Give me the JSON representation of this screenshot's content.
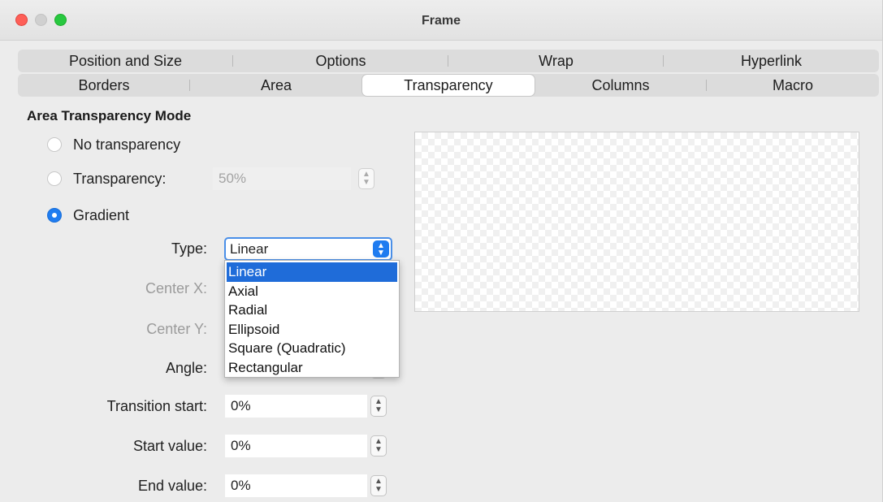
{
  "window": {
    "title": "Frame"
  },
  "tabs": {
    "row1": [
      "Position and Size",
      "Options",
      "Wrap",
      "Hyperlink"
    ],
    "row2": [
      "Borders",
      "Area",
      "Transparency",
      "Columns",
      "Macro"
    ],
    "active": "Transparency"
  },
  "section_title": "Area Transparency Mode",
  "modes": {
    "none_label": "No transparency",
    "transparency_label": "Transparency:",
    "transparency_value": "50%",
    "gradient_label": "Gradient",
    "selected": "Gradient"
  },
  "gradient": {
    "type_label": "Type:",
    "type_value": "Linear",
    "type_options": [
      "Linear",
      "Axial",
      "Radial",
      "Ellipsoid",
      "Square (Quadratic)",
      "Rectangular"
    ],
    "center_x_label": "Center X:",
    "center_y_label": "Center Y:",
    "angle_label": "Angle:",
    "transition_start_label": "Transition start:",
    "transition_start_value": "0%",
    "start_value_label": "Start value:",
    "start_value_value": "0%",
    "end_value_label": "End value:",
    "end_value_value": "0%"
  }
}
